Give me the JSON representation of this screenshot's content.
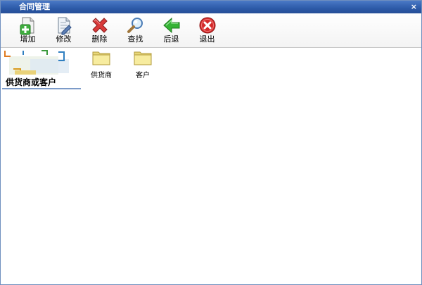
{
  "window": {
    "title": "合同管理",
    "close_glyph": "×"
  },
  "toolbar": {
    "buttons": [
      {
        "label": "增加",
        "icon": "add-document-icon"
      },
      {
        "label": "修改",
        "icon": "edit-document-icon"
      },
      {
        "label": "删除",
        "icon": "delete-x-icon"
      },
      {
        "label": "查找",
        "icon": "magnifier-icon"
      },
      {
        "label": "后退",
        "icon": "back-arrow-icon"
      },
      {
        "label": "退出",
        "icon": "exit-circle-icon"
      }
    ]
  },
  "panel": {
    "title": "供货商或客户"
  },
  "folders": [
    {
      "label": "供货商",
      "icon": "folder-icon"
    },
    {
      "label": "客户",
      "icon": "folder-icon"
    }
  ],
  "colors": {
    "titlebar": "#2c5aa8",
    "folder": "#f5e79a",
    "add_green": "#3fae3f",
    "delete_red": "#d93a3a",
    "back_green": "#35b335",
    "exit_red": "#d42b2b"
  }
}
